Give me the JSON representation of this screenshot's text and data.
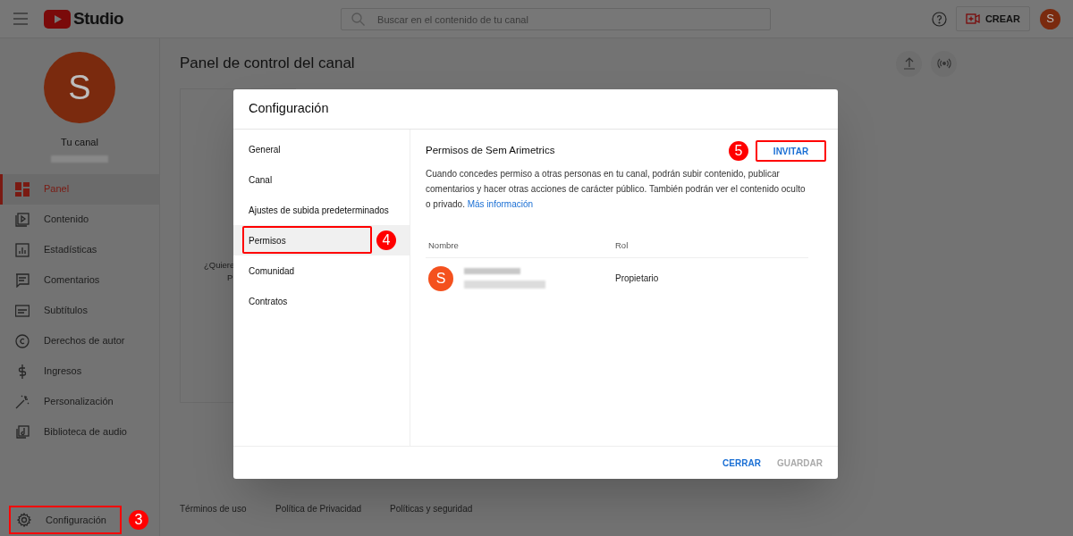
{
  "header": {
    "logo_text": "Studio",
    "search": {
      "placeholder": "Buscar en el contenido de tu canal"
    },
    "create_label": "CREAR",
    "avatar_letter": "S"
  },
  "sidebar": {
    "avatar_letter": "S",
    "channel_label": "Tu canal",
    "items": [
      {
        "label": "Panel",
        "kind": "dashboard",
        "selected": true
      },
      {
        "label": "Contenido",
        "kind": "content",
        "selected": false
      },
      {
        "label": "Estadísticas",
        "kind": "stats",
        "selected": false
      },
      {
        "label": "Comentarios",
        "kind": "comments",
        "selected": false
      },
      {
        "label": "Subtítulos",
        "kind": "subtitles",
        "selected": false
      },
      {
        "label": "Derechos de autor",
        "kind": "copyright",
        "selected": false
      },
      {
        "label": "Ingresos",
        "kind": "dollar",
        "selected": false
      },
      {
        "label": "Personalización",
        "kind": "wand",
        "selected": false
      },
      {
        "label": "Biblioteca de audio",
        "kind": "audio",
        "selected": false
      }
    ],
    "settings": {
      "label": "Configuración",
      "kind": "gear",
      "callout": "3"
    }
  },
  "page": {
    "title": "Panel de control del canal",
    "card_texts": [
      "¿Quiere",
      "P"
    ],
    "footer_links": [
      "Términos de uso",
      "Política de Privacidad",
      "Políticas y seguridad"
    ]
  },
  "dialog": {
    "title": "Configuración",
    "nav": [
      {
        "label": "General",
        "selected": false
      },
      {
        "label": "Canal",
        "selected": false
      },
      {
        "label": "Ajustes de subida predeterminados",
        "selected": false
      },
      {
        "label": "Permisos",
        "selected": true,
        "callout": "4"
      },
      {
        "label": "Comunidad",
        "selected": false
      },
      {
        "label": "Contratos",
        "selected": false
      }
    ],
    "heading": "Permisos de Sem Arimetrics",
    "invite": {
      "label": "INVITAR",
      "callout": "5"
    },
    "description": "Cuando concedes permiso a otras personas en tu canal, podrán subir contenido, publicar comentarios y hacer otras acciones de carácter público. También podrán ver el contenido oculto o privado.",
    "link": "Más información",
    "table": {
      "columns": [
        "Nombre",
        "Rol"
      ],
      "rows": [
        {
          "avatar_letter": "S",
          "role": "Propietario"
        }
      ]
    },
    "buttons": [
      {
        "label": "CERRAR",
        "disabled": false
      },
      {
        "label": "GUARDAR",
        "disabled": true
      }
    ]
  }
}
